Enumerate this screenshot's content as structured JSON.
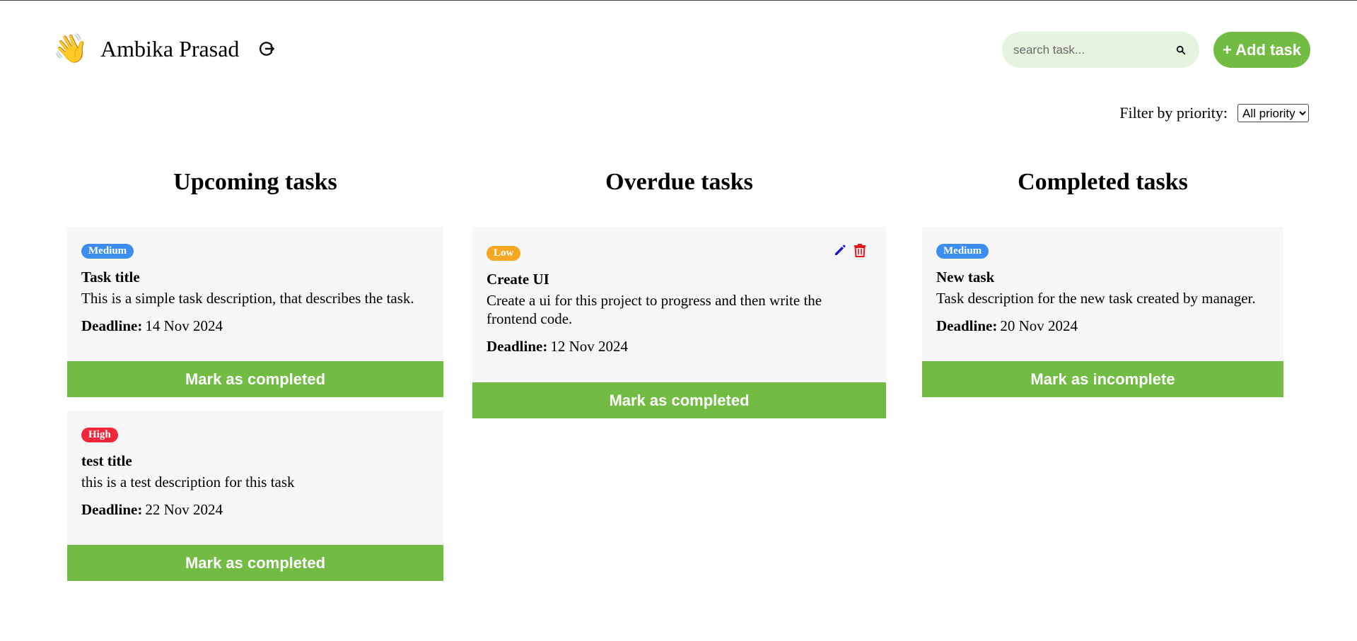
{
  "header": {
    "emoji": "👋",
    "username": "Ambika Prasad",
    "logout_icon": "logout-icon"
  },
  "search": {
    "placeholder": "search task...",
    "value": "",
    "icon": "search-icon"
  },
  "add_task_label": "+ Add task",
  "filter": {
    "label": "Filter by priority:",
    "selected": "All priority"
  },
  "colors": {
    "accent": "#72bc44",
    "search_bg": "#e6f4df",
    "card_bg": "#f7f7f7",
    "medium": "#3b8ef0",
    "low": "#f5a623",
    "high": "#f0263a",
    "edit": "#1a1acc",
    "delete": "#e8141c"
  },
  "columns": [
    {
      "title": "Upcoming tasks",
      "tasks": [
        {
          "priority": "Medium",
          "title": "Task title",
          "description": "This is a simple task description, that describes the task.",
          "deadline_label": "Deadline:",
          "deadline": "14 Nov 2024",
          "action": "Mark as completed"
        },
        {
          "priority": "High",
          "title": "test title",
          "description": "this is a test description for this task",
          "deadline_label": "Deadline:",
          "deadline": "22 Nov 2024",
          "action": "Mark as completed"
        }
      ]
    },
    {
      "title": "Overdue tasks",
      "tasks": [
        {
          "priority": "Low",
          "title": "Create UI",
          "description": "Create a ui for this project to progress and then write the frontend code.",
          "deadline_label": "Deadline:",
          "deadline": "12 Nov 2024",
          "action": "Mark as completed",
          "edit_icon": "pencil-icon",
          "delete_icon": "trash-icon"
        }
      ]
    },
    {
      "title": "Completed tasks",
      "tasks": [
        {
          "priority": "Medium",
          "title": "New task",
          "description": "Task description for the new task created by manager.",
          "deadline_label": "Deadline:",
          "deadline": "20 Nov 2024",
          "action": "Mark as incomplete"
        }
      ]
    }
  ]
}
